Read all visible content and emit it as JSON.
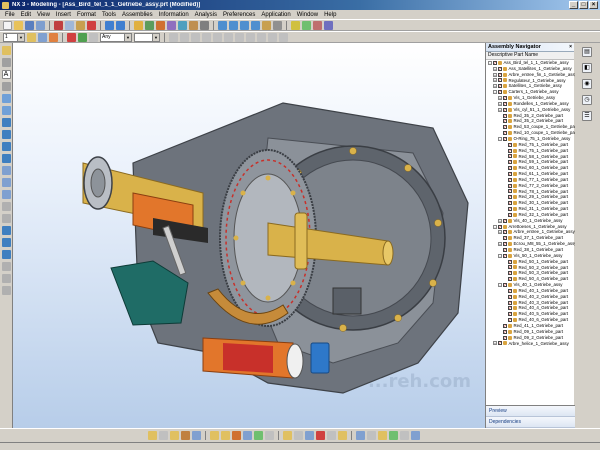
{
  "window": {
    "title": "NX 3 - Modeling - [Ass_Bird_tel_1_1_Getriebe_assy.prt (Modified)]",
    "minimize": "_",
    "maximize": "□",
    "close": "×"
  },
  "menu": [
    "File",
    "Edit",
    "View",
    "Insert",
    "Format",
    "Tools",
    "Assemblies",
    "Information",
    "Analysis",
    "Preferences",
    "Application",
    "Window",
    "Help"
  ],
  "toolbar": {
    "layer_combo": "1",
    "filter_combo": "Any"
  },
  "navigator": {
    "title": "Assembly Navigator",
    "column_header": "Descriptive Part Name",
    "close": "×",
    "rows": [
      {
        "label": "Ass_Bird_tel_1_1_Getriebe_assy",
        "depth": 0,
        "expander": "-"
      },
      {
        "label": "Ass_Satellites_1_Getriebe_assy",
        "depth": 1,
        "expander": "+"
      },
      {
        "label": "Arbre_entree_fin_1_Getriebe_assy",
        "depth": 1,
        "expander": "+"
      },
      {
        "label": "Regulateur_1_Getriebe_assy",
        "depth": 1,
        "expander": "+"
      },
      {
        "label": "Satellites_1_Getriebe_assy",
        "depth": 1,
        "expander": "+"
      },
      {
        "label": "Carters_1_Getriebe_assy",
        "depth": 1,
        "expander": "-"
      },
      {
        "label": "Vis_1_Getriebe_assy",
        "depth": 2,
        "expander": "+"
      },
      {
        "label": "Rondelles_1_Getriebe_assy",
        "depth": 2,
        "expander": "+"
      },
      {
        "label": "Vis_cyl_51_1_Getriebe_assy",
        "depth": 2,
        "expander": "+"
      },
      {
        "label": "Red_35_2_Getriebe_part",
        "depth": 2,
        "expander": ""
      },
      {
        "label": "Red_35_2_Getriebe_part",
        "depth": 2,
        "expander": ""
      },
      {
        "label": "Red_53_coupe_1_Getriebe_part",
        "depth": 2,
        "expander": ""
      },
      {
        "label": "Red_10_coupe_1_Getriebe_part",
        "depth": 2,
        "expander": ""
      },
      {
        "label": "O-Ring_75_1_Getriebe_assy",
        "depth": 2,
        "expander": "-"
      },
      {
        "label": "Red_75_1_Getriebe_part",
        "depth": 3,
        "expander": ""
      },
      {
        "label": "Red_75_1_Getriebe_part",
        "depth": 3,
        "expander": ""
      },
      {
        "label": "Red_58_1_Getriebe_part",
        "depth": 3,
        "expander": ""
      },
      {
        "label": "Red_59_1_Getriebe_part",
        "depth": 3,
        "expander": ""
      },
      {
        "label": "Red_60_1_Getriebe_part",
        "depth": 3,
        "expander": ""
      },
      {
        "label": "Red_61_1_Getriebe_part",
        "depth": 3,
        "expander": ""
      },
      {
        "label": "Red_77_1_Getriebe_part",
        "depth": 3,
        "expander": ""
      },
      {
        "label": "Red_77_2_Getriebe_part",
        "depth": 3,
        "expander": ""
      },
      {
        "label": "Red_78_1_Getriebe_part",
        "depth": 3,
        "expander": ""
      },
      {
        "label": "Red_29_1_Getriebe_part",
        "depth": 3,
        "expander": ""
      },
      {
        "label": "Red_30_1_Getriebe_part",
        "depth": 3,
        "expander": ""
      },
      {
        "label": "Red_31_1_Getriebe_part",
        "depth": 3,
        "expander": ""
      },
      {
        "label": "Red_32_1_Getriebe_part",
        "depth": 3,
        "expander": ""
      },
      {
        "label": "Vis_40_1_Getriebe_assy",
        "depth": 2,
        "expander": "+"
      },
      {
        "label": "Arrettoeses_1_Getriebe_assy",
        "depth": 1,
        "expander": "-"
      },
      {
        "label": "Arbre_entree_1_Getriebe_assy",
        "depth": 2,
        "expander": "+"
      },
      {
        "label": "Red_37_1_Getriebe_part",
        "depth": 2,
        "expander": ""
      },
      {
        "label": "Ecrou_M8_55_1_Getriebe_assy",
        "depth": 2,
        "expander": "+"
      },
      {
        "label": "Red_38_1_Getriebe_part",
        "depth": 2,
        "expander": ""
      },
      {
        "label": "Vis_50_1_Getriebe_assy",
        "depth": 2,
        "expander": "-"
      },
      {
        "label": "Red_50_1_Getriebe_part",
        "depth": 3,
        "expander": ""
      },
      {
        "label": "Red_50_2_Getriebe_part",
        "depth": 3,
        "expander": ""
      },
      {
        "label": "Red_50_3_Getriebe_part",
        "depth": 3,
        "expander": ""
      },
      {
        "label": "Red_50_4_Getriebe_part",
        "depth": 3,
        "expander": ""
      },
      {
        "label": "Vis_40_1_Getriebe_assy",
        "depth": 2,
        "expander": "-"
      },
      {
        "label": "Red_40_1_Getriebe_part",
        "depth": 3,
        "expander": ""
      },
      {
        "label": "Red_40_2_Getriebe_part",
        "depth": 3,
        "expander": ""
      },
      {
        "label": "Red_40_3_Getriebe_part",
        "depth": 3,
        "expander": ""
      },
      {
        "label": "Red_40_4_Getriebe_part",
        "depth": 3,
        "expander": ""
      },
      {
        "label": "Red_40_5_Getriebe_part",
        "depth": 3,
        "expander": ""
      },
      {
        "label": "Red_40_6_Getriebe_part",
        "depth": 3,
        "expander": ""
      },
      {
        "label": "Red_41_1_Getriebe_part",
        "depth": 2,
        "expander": ""
      },
      {
        "label": "Red_09_1_Getriebe_part",
        "depth": 2,
        "expander": ""
      },
      {
        "label": "Red_09_2_Getriebe_part",
        "depth": 2,
        "expander": ""
      },
      {
        "label": "Arbre_helice_1_Getriebe_assy",
        "depth": 1,
        "expander": "+"
      }
    ],
    "panels": [
      "Preview",
      "Dependencies"
    ]
  },
  "watermark": "...reh.com",
  "colors": {
    "title_bar": "#0a246a",
    "housing": "#6d737c",
    "brass": "#d9b24a",
    "copper": "#e2762b",
    "teal": "#1f6c66",
    "blue": "#2e78c9"
  }
}
